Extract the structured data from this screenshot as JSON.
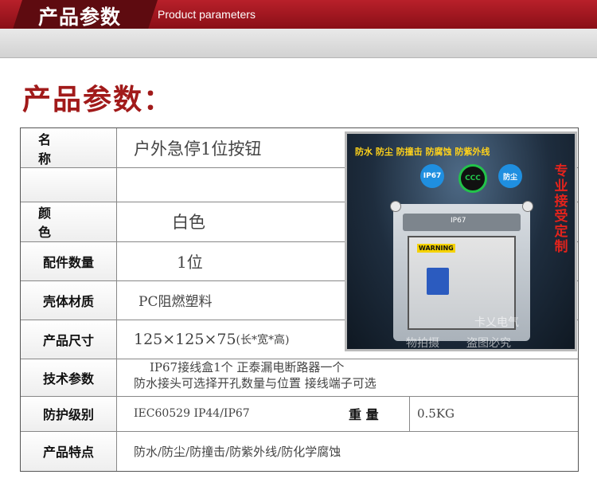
{
  "banner": {
    "title_zh": "产品参数",
    "title_en": "Product parameters"
  },
  "heading": "产品参数：",
  "rows": [
    {
      "label": "名 称",
      "value": "户外急停1位按钮"
    },
    {
      "label": "",
      "value": ""
    },
    {
      "label": "颜 色",
      "value": "白色"
    },
    {
      "label": "配件数量",
      "value": "1位"
    },
    {
      "label": "壳体材质",
      "value": "PC阻燃塑料"
    },
    {
      "label": "产品尺寸",
      "value": "125×125×75",
      "value_suffix": "(长*宽*高)"
    },
    {
      "label": "技术参数",
      "value_line1": "IP67接线盒1个  正泰漏电断路器一个",
      "value_line2": "防水接头可选择开孔数量与位置 接线端子可选"
    },
    {
      "label": "防护级别",
      "value": "IEC60529 IP44/IP67",
      "extra_label": "重 量",
      "extra_value": "0.5KG"
    },
    {
      "label": "产品特点",
      "value": "防水/防尘/防撞击/防紫外线/防化学腐蚀"
    }
  ],
  "photo": {
    "caption": "防水 防尘 防撞击 防腐蚀 防紫外线",
    "side_text": "专业接受定制",
    "badges": [
      "IP67",
      "CCC",
      "防尘"
    ],
    "lid_label": "IP67",
    "warning": "WARNING",
    "watermark1": "卡乂电气",
    "watermark2": "物拍摄",
    "watermark3": "盗图必究",
    "colors": {
      "caption": "#ffd21a",
      "side_text": "#e3231c",
      "ccc": "#22c34a",
      "badge": "#1f8fe0"
    }
  },
  "colors": {
    "banner": "#a5121c",
    "heading": "#a11a1a"
  }
}
